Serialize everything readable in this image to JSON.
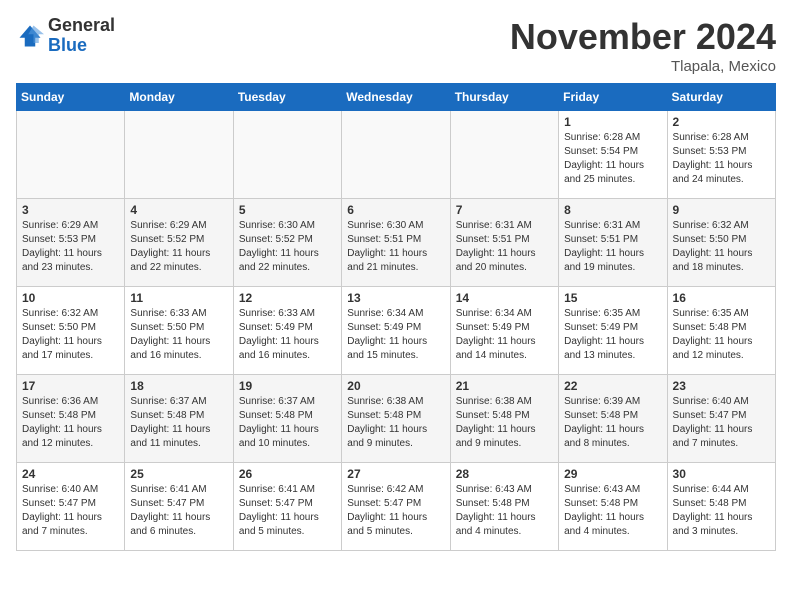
{
  "header": {
    "logo_general": "General",
    "logo_blue": "Blue",
    "month_title": "November 2024",
    "location": "Tlapala, Mexico"
  },
  "days_of_week": [
    "Sunday",
    "Monday",
    "Tuesday",
    "Wednesday",
    "Thursday",
    "Friday",
    "Saturday"
  ],
  "weeks": [
    [
      {
        "day": "",
        "info": ""
      },
      {
        "day": "",
        "info": ""
      },
      {
        "day": "",
        "info": ""
      },
      {
        "day": "",
        "info": ""
      },
      {
        "day": "",
        "info": ""
      },
      {
        "day": "1",
        "info": "Sunrise: 6:28 AM\nSunset: 5:54 PM\nDaylight: 11 hours\nand 25 minutes."
      },
      {
        "day": "2",
        "info": "Sunrise: 6:28 AM\nSunset: 5:53 PM\nDaylight: 11 hours\nand 24 minutes."
      }
    ],
    [
      {
        "day": "3",
        "info": "Sunrise: 6:29 AM\nSunset: 5:53 PM\nDaylight: 11 hours\nand 23 minutes."
      },
      {
        "day": "4",
        "info": "Sunrise: 6:29 AM\nSunset: 5:52 PM\nDaylight: 11 hours\nand 22 minutes."
      },
      {
        "day": "5",
        "info": "Sunrise: 6:30 AM\nSunset: 5:52 PM\nDaylight: 11 hours\nand 22 minutes."
      },
      {
        "day": "6",
        "info": "Sunrise: 6:30 AM\nSunset: 5:51 PM\nDaylight: 11 hours\nand 21 minutes."
      },
      {
        "day": "7",
        "info": "Sunrise: 6:31 AM\nSunset: 5:51 PM\nDaylight: 11 hours\nand 20 minutes."
      },
      {
        "day": "8",
        "info": "Sunrise: 6:31 AM\nSunset: 5:51 PM\nDaylight: 11 hours\nand 19 minutes."
      },
      {
        "day": "9",
        "info": "Sunrise: 6:32 AM\nSunset: 5:50 PM\nDaylight: 11 hours\nand 18 minutes."
      }
    ],
    [
      {
        "day": "10",
        "info": "Sunrise: 6:32 AM\nSunset: 5:50 PM\nDaylight: 11 hours\nand 17 minutes."
      },
      {
        "day": "11",
        "info": "Sunrise: 6:33 AM\nSunset: 5:50 PM\nDaylight: 11 hours\nand 16 minutes."
      },
      {
        "day": "12",
        "info": "Sunrise: 6:33 AM\nSunset: 5:49 PM\nDaylight: 11 hours\nand 16 minutes."
      },
      {
        "day": "13",
        "info": "Sunrise: 6:34 AM\nSunset: 5:49 PM\nDaylight: 11 hours\nand 15 minutes."
      },
      {
        "day": "14",
        "info": "Sunrise: 6:34 AM\nSunset: 5:49 PM\nDaylight: 11 hours\nand 14 minutes."
      },
      {
        "day": "15",
        "info": "Sunrise: 6:35 AM\nSunset: 5:49 PM\nDaylight: 11 hours\nand 13 minutes."
      },
      {
        "day": "16",
        "info": "Sunrise: 6:35 AM\nSunset: 5:48 PM\nDaylight: 11 hours\nand 12 minutes."
      }
    ],
    [
      {
        "day": "17",
        "info": "Sunrise: 6:36 AM\nSunset: 5:48 PM\nDaylight: 11 hours\nand 12 minutes."
      },
      {
        "day": "18",
        "info": "Sunrise: 6:37 AM\nSunset: 5:48 PM\nDaylight: 11 hours\nand 11 minutes."
      },
      {
        "day": "19",
        "info": "Sunrise: 6:37 AM\nSunset: 5:48 PM\nDaylight: 11 hours\nand 10 minutes."
      },
      {
        "day": "20",
        "info": "Sunrise: 6:38 AM\nSunset: 5:48 PM\nDaylight: 11 hours\nand 9 minutes."
      },
      {
        "day": "21",
        "info": "Sunrise: 6:38 AM\nSunset: 5:48 PM\nDaylight: 11 hours\nand 9 minutes."
      },
      {
        "day": "22",
        "info": "Sunrise: 6:39 AM\nSunset: 5:48 PM\nDaylight: 11 hours\nand 8 minutes."
      },
      {
        "day": "23",
        "info": "Sunrise: 6:40 AM\nSunset: 5:47 PM\nDaylight: 11 hours\nand 7 minutes."
      }
    ],
    [
      {
        "day": "24",
        "info": "Sunrise: 6:40 AM\nSunset: 5:47 PM\nDaylight: 11 hours\nand 7 minutes."
      },
      {
        "day": "25",
        "info": "Sunrise: 6:41 AM\nSunset: 5:47 PM\nDaylight: 11 hours\nand 6 minutes."
      },
      {
        "day": "26",
        "info": "Sunrise: 6:41 AM\nSunset: 5:47 PM\nDaylight: 11 hours\nand 5 minutes."
      },
      {
        "day": "27",
        "info": "Sunrise: 6:42 AM\nSunset: 5:47 PM\nDaylight: 11 hours\nand 5 minutes."
      },
      {
        "day": "28",
        "info": "Sunrise: 6:43 AM\nSunset: 5:48 PM\nDaylight: 11 hours\nand 4 minutes."
      },
      {
        "day": "29",
        "info": "Sunrise: 6:43 AM\nSunset: 5:48 PM\nDaylight: 11 hours\nand 4 minutes."
      },
      {
        "day": "30",
        "info": "Sunrise: 6:44 AM\nSunset: 5:48 PM\nDaylight: 11 hours\nand 3 minutes."
      }
    ]
  ]
}
